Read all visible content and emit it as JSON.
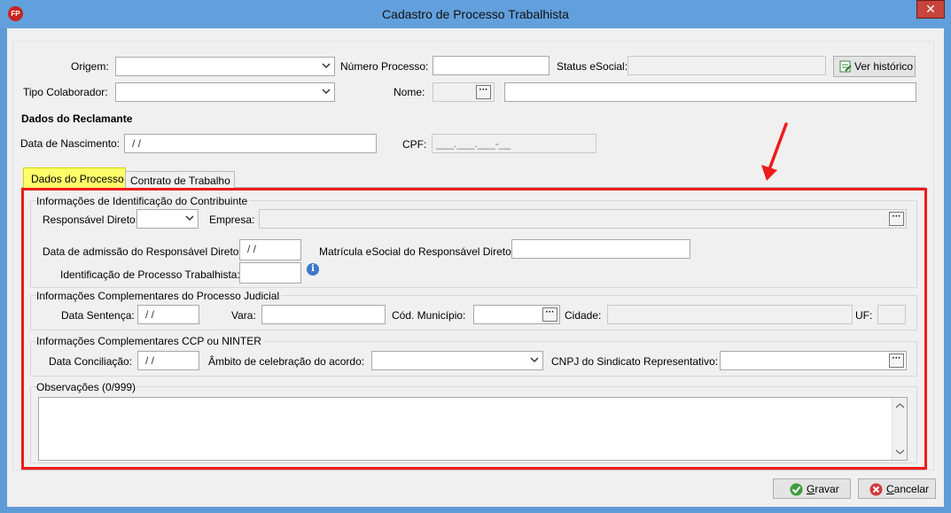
{
  "window": {
    "title": "Cadastro de Processo Trabalhista",
    "app_badge": "FP",
    "close_glyph": "✕"
  },
  "header": {
    "origem_label": "Origem:",
    "numero_processo_label": "Número Processo:",
    "status_esocial_label": "Status eSocial:",
    "ver_historico_label": "Ver histórico",
    "tipo_colaborador_label": "Tipo Colaborador:",
    "nome_label": "Nome:",
    "lookup_glyph": "···"
  },
  "reclamante": {
    "section_title": "Dados do Reclamante",
    "data_nascimento_label": "Data de Nascimento:",
    "data_nascimento_value": "/ /",
    "cpf_label": "CPF:",
    "cpf_value": "___.___.___-__"
  },
  "tabs": [
    {
      "label": "Dados do Processo"
    },
    {
      "label": "Contrato de Trabalho"
    }
  ],
  "identificacao": {
    "title": "Informações de Identificação do Contribuinte",
    "responsavel_direto_label": "Responsável Direto:",
    "empresa_label": "Empresa:",
    "data_admissao_label": "Data de admissão do Responsável Direto:",
    "data_admissao_value": "/ /",
    "matricula_label": "Matrícula eSocial do Responsável Direto",
    "identificacao_processo_label": "Identificação de Processo Trabalhista:",
    "info_glyph": "i"
  },
  "judicial": {
    "title": "Informações Complementares do Processo Judicial",
    "data_sentenca_label": "Data Sentença:",
    "data_sentenca_value": "/ /",
    "vara_label": "Vara:",
    "cod_municipio_label": "Cód. Município:",
    "cidade_label": "Cidade:",
    "uf_label": "UF:"
  },
  "ccp": {
    "title": "Informações Complementares CCP ou NINTER",
    "data_conciliacao_label": "Data Conciliação:",
    "data_conciliacao_value": "/ /",
    "ambito_label": "Âmbito de celebração do acordo:",
    "cnpj_label": "CNPJ do Sindicato Representativo:"
  },
  "observacoes": {
    "title": "Observações (0/999)"
  },
  "footer": {
    "gravar_first": "G",
    "gravar_rest": "ravar",
    "cancelar_first": "C",
    "cancelar_rest": "ancelar"
  },
  "colors": {
    "accent_red": "#ee1b1b",
    "tab_highlight": "#ffff6a",
    "titlebar": "#62a0dd"
  },
  "icons": [
    "close-icon",
    "chevron-down-icon",
    "ellipsis-icon",
    "info-icon",
    "history-icon",
    "check-icon",
    "cancel-icon",
    "scroll-up-icon",
    "scroll-down-icon"
  ]
}
